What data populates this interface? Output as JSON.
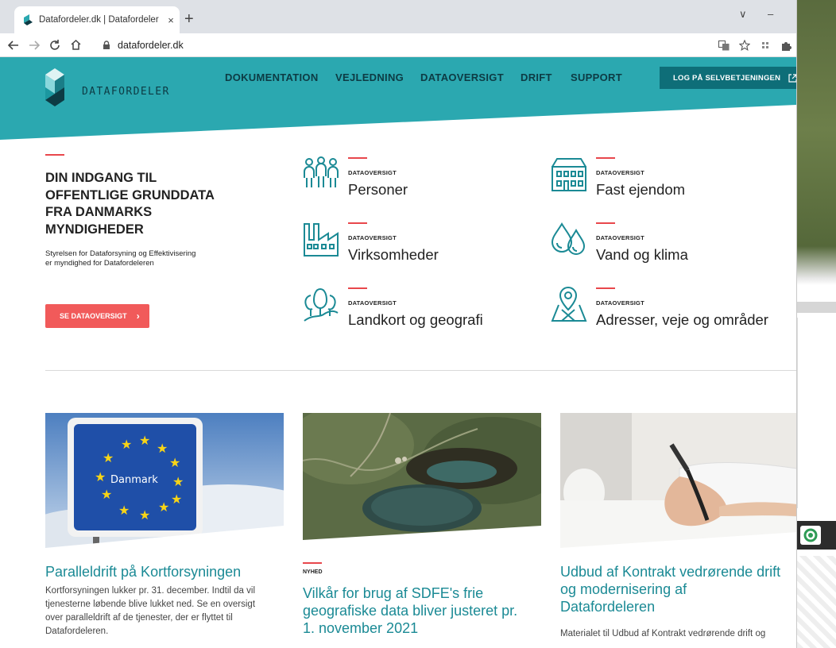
{
  "browser": {
    "tab_title": "Datafordeler.dk | Datafordeler",
    "tab_close": "×",
    "new_tab": "+",
    "url": "datafordeler.dk",
    "minimize": "–",
    "dropdown": "∨"
  },
  "header": {
    "logo_text": "DATAFORDELER",
    "nav": [
      "DOKUMENTATION",
      "VEJLEDNING",
      "DATAOVERSIGT",
      "DRIFT",
      "SUPPORT"
    ],
    "login_label": "LOG PÅ SELVBETJENINGEN",
    "login_icon": "external-link-icon"
  },
  "hero": {
    "title_lines": [
      "DIN INDGANG TIL",
      "OFFENTLIGE GRUNDDATA",
      "FRA DANMARKS",
      "MYNDIGHEDER"
    ],
    "subtitle_lines": [
      "Styrelsen for Dataforsyning og Effektivisering",
      "er myndighed for Datafordeleren"
    ],
    "cta_label": "SE DATAOVERSIGT"
  },
  "categories": [
    {
      "kicker": "DATAOVERSIGT",
      "name": "Personer",
      "icon": "people-icon"
    },
    {
      "kicker": "DATAOVERSIGT",
      "name": "Fast ejendom",
      "icon": "building-icon"
    },
    {
      "kicker": "DATAOVERSIGT",
      "name": "Virksomheder",
      "icon": "factory-icon"
    },
    {
      "kicker": "DATAOVERSIGT",
      "name": "Vand og klima",
      "icon": "water-drops-icon"
    },
    {
      "kicker": "DATAOVERSIGT",
      "name": "Landkort og geografi",
      "icon": "trees-landscape-icon"
    },
    {
      "kicker": "DATAOVERSIGT",
      "name": "Adresser, veje og områder",
      "icon": "map-pin-icon"
    }
  ],
  "news": [
    {
      "sign_text": "Danmark",
      "title_lines": [
        "Paralleldrift på Kortforsyningen"
      ],
      "text_lines": [
        "Kortforsyningen lukker pr. 31. december. Indtil da vil",
        "tjenesterne løbende blive lukket ned. Se en oversigt",
        "over paralleldrift af de tjenester, der er flyttet til",
        "Datafordeleren."
      ]
    },
    {
      "kicker": "NYHED",
      "title_lines": [
        "Vilkår for brug af SDFE's frie",
        "geografiske data bliver justeret pr.",
        "1. november 2021"
      ]
    },
    {
      "title_lines": [
        "Udbud af Kontrakt vedrørende drift",
        "og modernisering af",
        "Datafordeleren"
      ],
      "text_lines": [
        "Materialet til Udbud af Kontrakt vedrørende drift og"
      ]
    }
  ],
  "colors": {
    "teal": "#2ba8b0",
    "dark_teal": "#0e6e78",
    "red": "#f15a5a",
    "link": "#1b8a95"
  }
}
